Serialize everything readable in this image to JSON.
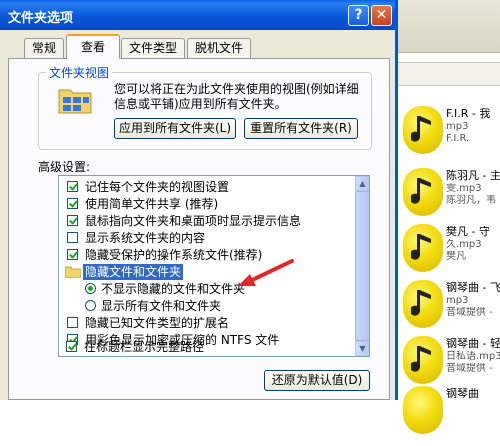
{
  "background": {
    "files": [
      {
        "name": "F.I.R - 我",
        "line2": "mp3",
        "line3": "F.I.R."
      },
      {
        "name": "陈羽凡 - 主",
        "line2": "雯.mp3",
        "line3": "陈羽凡，韦"
      },
      {
        "name": "樊凡 - 守",
        "line2": "久.mp3",
        "line3": "樊凡"
      },
      {
        "name": "钢琴曲 - 飞",
        "line2": "mp3",
        "line3": "音域提供 -"
      },
      {
        "name": "钢琴曲 - 轻",
        "line2": "日私语.mp3",
        "line3": "音域提供 -"
      },
      {
        "name": "钢琴曲",
        "line2": "",
        "line3": ""
      }
    ]
  },
  "dialog": {
    "title": "文件夹选项",
    "help_symbol": "?",
    "close_symbol": "✕",
    "tabs": [
      "常规",
      "查看",
      "文件类型",
      "脱机文件"
    ],
    "active_tab": "查看",
    "folder_view": {
      "title": "文件夹视图",
      "description": "您可以将正在为此文件夹使用的视图(例如详细信息或平铺)应用到所有文件夹。",
      "apply_button": "应用到所有文件夹(L)",
      "reset_button": "重置所有文件夹(R)"
    },
    "advanced_label": "高级设置:",
    "advanced": {
      "rows": [
        {
          "label": "记住每个文件夹的视图设置",
          "checked": true
        },
        {
          "label": "使用简单文件共享 (推荐)",
          "checked": true
        },
        {
          "label": "鼠标指向文件夹和桌面项时显示提示信息",
          "checked": true
        },
        {
          "label": "显示系统文件夹的内容",
          "checked": false
        },
        {
          "label": "隐藏受保护的操作系统文件(推荐)",
          "checked": true
        }
      ],
      "folder_item": "隐藏文件和文件夹",
      "radios": [
        {
          "label": "不显示隐藏的文件和文件夹",
          "selected": true
        },
        {
          "label": "显示所有文件和文件夹",
          "selected": false
        }
      ],
      "rows_after": [
        {
          "label": "隐藏已知文件类型的扩展名",
          "checked": false
        },
        {
          "label": "用彩色显示加密或压缩的 NTFS 文件",
          "checked": true
        },
        {
          "label": "在标题栏显示完整路径",
          "checked": true
        }
      ]
    },
    "restore_button": "还原为默认值(D)",
    "colors": {
      "titlebar": "#0a5ad8",
      "selection": "#316ac5",
      "annotation_arrow": "#e0262b",
      "check": "#21a121"
    }
  }
}
